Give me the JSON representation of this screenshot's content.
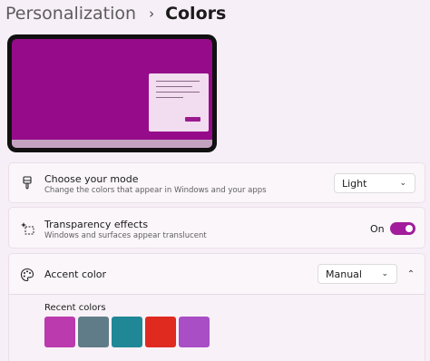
{
  "breadcrumb": {
    "parent": "Personalization",
    "separator": "›",
    "current": "Colors"
  },
  "preview": {
    "desktop_color": "#960b8a",
    "window_color": "#f2dcef"
  },
  "settings": {
    "mode": {
      "icon": "brush-icon",
      "title": "Choose your mode",
      "subtitle": "Change the colors that appear in Windows and your apps",
      "value": "Light"
    },
    "transparency": {
      "icon": "transparency-sparkle-icon",
      "title": "Transparency effects",
      "subtitle": "Windows and surfaces appear translucent",
      "state_label": "On",
      "enabled": true
    },
    "accent": {
      "icon": "palette-icon",
      "title": "Accent color",
      "value": "Manual",
      "expanded": true,
      "recent_label": "Recent colors",
      "recent_colors": [
        "#bb3aad",
        "#617c89",
        "#1f8796",
        "#e02a20",
        "#a94ec4"
      ]
    }
  },
  "colors": {
    "accent": "#a11d9b",
    "background": "#f7eff7"
  }
}
